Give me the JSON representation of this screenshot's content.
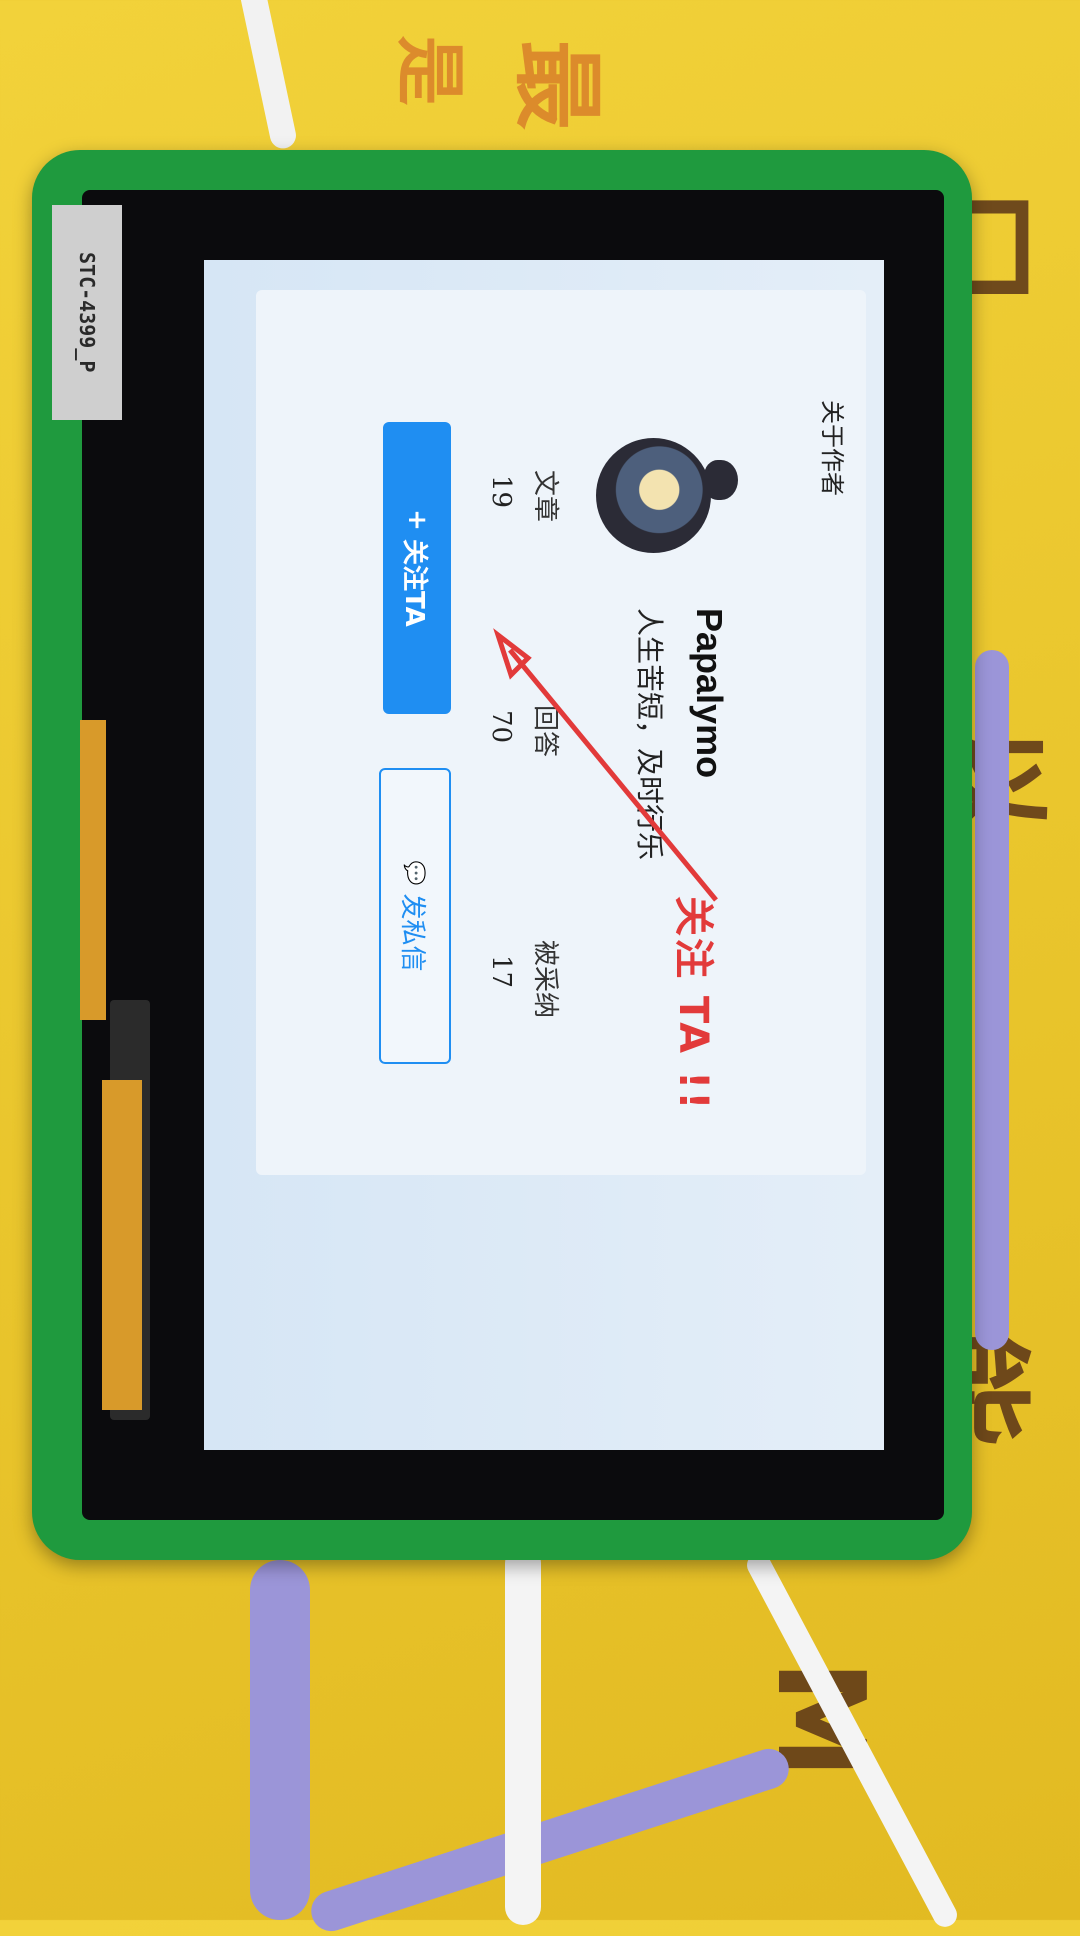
{
  "device": {
    "model_label": "STC-4399_P"
  },
  "screen": {
    "header_title": "关于作者",
    "profile": {
      "username": "Papalymo",
      "bio": "人生苦短，及时行乐"
    },
    "stats": [
      {
        "label": "文章",
        "value": "19"
      },
      {
        "label": "回答",
        "value": "70"
      },
      {
        "label": "被采纳",
        "value": "17"
      }
    ],
    "buttons": {
      "follow_icon": "+",
      "follow_label": "关注TA",
      "message_icon": "💬",
      "message_label": "发私信"
    },
    "annotation": "关注 TA !!"
  },
  "colors": {
    "primary": "#1f8ef2",
    "annotation": "#e23a3a",
    "device_green": "#1f9a3e"
  }
}
